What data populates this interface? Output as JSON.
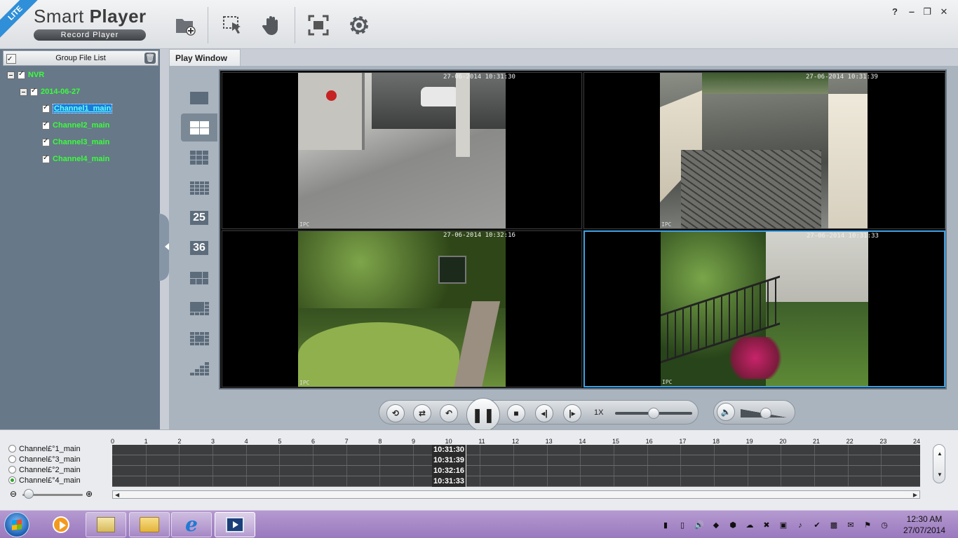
{
  "app": {
    "badge": "LITE",
    "title_light": "Smart ",
    "title_bold": "Player",
    "subtitle": "Record Player"
  },
  "toolbar": {
    "tools": [
      {
        "name": "open-folder-icon",
        "glyph": "folder-plus"
      },
      {
        "name": "select-pointer-icon",
        "glyph": "cursor"
      },
      {
        "name": "hand-pan-icon",
        "glyph": "hand"
      },
      {
        "name": "fullscreen-icon",
        "glyph": "expand"
      },
      {
        "name": "settings-gear-icon",
        "glyph": "gear"
      }
    ]
  },
  "window_controls": {
    "help": "?",
    "minimize": "‒",
    "restore": "❐",
    "close": "✕"
  },
  "file_list": {
    "header": "Group File List",
    "root": "NVR",
    "date": "2014-06-27",
    "channels": [
      "Channel1_main",
      "Channel2_main",
      "Channel3_main",
      "Channel4_main"
    ],
    "selected_index": 0
  },
  "play_window": {
    "tab_label": "Play Window",
    "layouts": [
      "1",
      "4",
      "9",
      "16",
      "25",
      "36",
      "6",
      "8",
      "13",
      "custom"
    ],
    "active_layout": 1,
    "feeds": [
      {
        "time": "27-06-2014 10:31:30",
        "cam": "IPC"
      },
      {
        "time": "27-06-2014 10:31:39",
        "cam": "IPC"
      },
      {
        "time": "27-06-2014 10:32:16",
        "cam": "IPC"
      },
      {
        "time": "27-06-2014 10:31:33",
        "cam": "IPC"
      }
    ],
    "active_cell": 3
  },
  "controls": {
    "speed_label": "1X",
    "speed_value": 0.5,
    "volume_value": 0.55,
    "buttons": [
      "loop",
      "shuffle",
      "rewind",
      "pause",
      "stop",
      "prev-frame",
      "next-frame"
    ]
  },
  "timeline": {
    "channels": [
      {
        "label": "Channel£°1_main",
        "selected": false
      },
      {
        "label": "Channel£°3_main",
        "selected": false
      },
      {
        "label": "Channel£°2_main",
        "selected": false
      },
      {
        "label": "Channel£°4_main",
        "selected": true
      }
    ],
    "hours": [
      "0",
      "1",
      "2",
      "3",
      "4",
      "5",
      "6",
      "7",
      "8",
      "9",
      "10",
      "11",
      "12",
      "13",
      "14",
      "15",
      "16",
      "17",
      "18",
      "19",
      "20",
      "21",
      "22",
      "23",
      "24"
    ],
    "marks": [
      "10:31:30",
      "10:31:39",
      "10:32:16",
      "10:31:33"
    ],
    "zoom_value": 0.1
  },
  "taskbar": {
    "time": "12:30 AM",
    "date": "27/07/2014",
    "items": [
      "media-player-icon",
      "document-viewer-icon",
      "file-explorer-icon",
      "internet-explorer-icon",
      "smart-player-icon"
    ]
  },
  "colors": {
    "tree_text": "#39ff39",
    "accent_border": "#3ba0e6",
    "panel_bg": "#677889"
  }
}
